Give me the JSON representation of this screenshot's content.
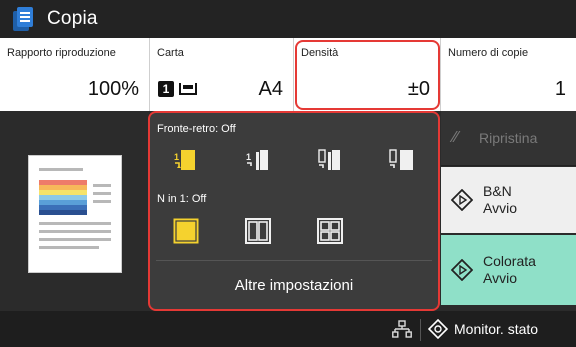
{
  "header": {
    "title": "Copia",
    "app_icon": "copy-document-icon"
  },
  "settings": {
    "ratio": {
      "label": "Rapporto riproduzione",
      "value": "100%"
    },
    "paper": {
      "label": "Carta",
      "tray": "1",
      "value": "A4"
    },
    "density": {
      "label": "Densità",
      "value": "±0"
    },
    "copies": {
      "label": "Numero di copie",
      "value": "1"
    }
  },
  "panel": {
    "duplex_label": "Fronte-retro: Off",
    "nup_label": "N in 1: Off",
    "more_label": "Altre impostazioni"
  },
  "actions": {
    "reset_label": "Ripristina",
    "bw_line1": "B&N",
    "bw_line2": "Avvio",
    "color_line1": "Colorata",
    "color_line2": "Avvio"
  },
  "status": {
    "monitor_label": "Monitor. stato"
  },
  "colors": {
    "accent_yellow": "#f5d22e",
    "start_color": "#8fe0c8",
    "highlight_red": "#e53935"
  }
}
